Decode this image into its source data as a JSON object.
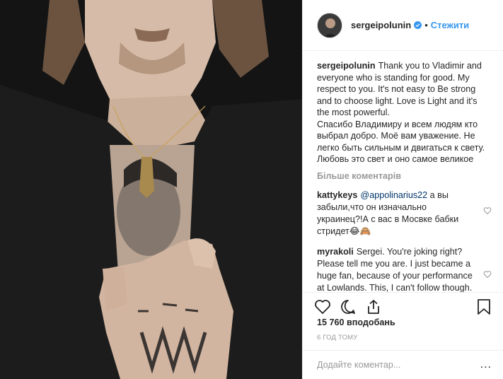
{
  "post": {
    "image_alt": "",
    "author": {
      "username": "sergeipolunin",
      "verified": true,
      "follow_label": "Стежити",
      "separator": "•"
    },
    "caption": {
      "username": "sergeipolunin",
      "text_en": "Thank you to Vladimir and everyone who is standing for good. My respect to you. It's not easy to Be strong and to choose light. Love is Light and it's the most powerful.",
      "text_ru": "Спасибо Владимиру и всем людям кто выбрал добро. Моё вам уважение. Не легко быть сильным и двигаться к свету. Любовь это свет и оно самое великое"
    },
    "load_more_label": "Більше коментарів",
    "comments": [
      {
        "username": "kattykeys",
        "mention": "@appolinarius22",
        "text": "а вы забыли,что он изначально украинец?!А с вас в Мосвке бабки стридет😂🙈"
      },
      {
        "username": "myrakoli",
        "mention": "",
        "text": "Sergei. You're joking right? Please tell me you are. I just became a huge fan, because of your performance at Lowlands. This, I can't follow though. Please tell me this is"
      }
    ],
    "likes_text": "15 760 вподобань",
    "time_text": "6 год тому",
    "add_comment_placeholder": "Додайте коментар...",
    "more_options_label": "...",
    "icons": {
      "like": "heart-icon",
      "comment": "comment-bubble-icon",
      "share": "share-icon",
      "save": "bookmark-icon",
      "comment_like": "heart-outline-icon",
      "verified": "verified-badge-icon"
    },
    "colors": {
      "accent": "#3897f0",
      "text": "#262626",
      "muted": "#999999",
      "border": "#efefef"
    }
  }
}
